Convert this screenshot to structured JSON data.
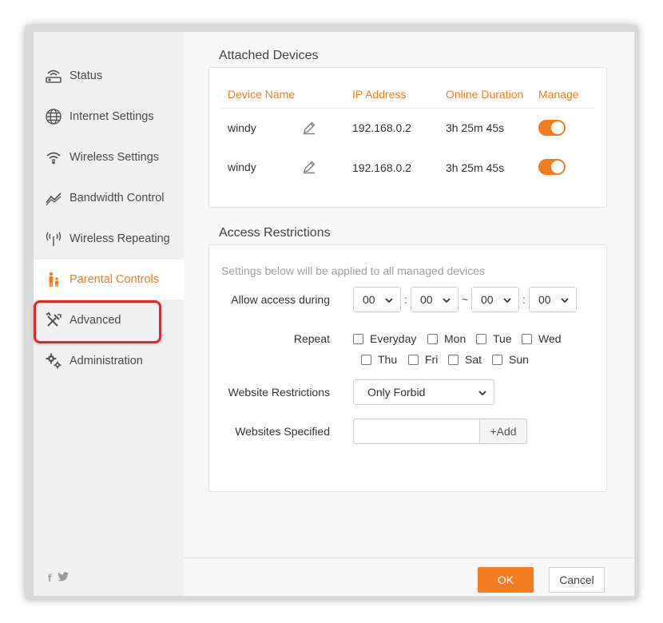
{
  "colors": {
    "accent": "#f47c20",
    "highlight": "#e0262b",
    "sidebar_bg": "#f0f0f0"
  },
  "sidebar": {
    "items": [
      {
        "label": "Status",
        "icon": "router-icon"
      },
      {
        "label": "Internet Settings",
        "icon": "globe-icon"
      },
      {
        "label": "Wireless Settings",
        "icon": "wifi-icon"
      },
      {
        "label": "Bandwidth Control",
        "icon": "bandwidth-icon"
      },
      {
        "label": "Wireless Repeating",
        "icon": "antenna-icon"
      },
      {
        "label": "Parental Controls",
        "icon": "family-icon",
        "active": true
      },
      {
        "label": "Advanced",
        "icon": "tools-icon"
      },
      {
        "label": "Administration",
        "icon": "gears-icon"
      }
    ],
    "social": {
      "facebook": "f",
      "twitter": "twitter-icon"
    }
  },
  "attached_devices": {
    "title": "Attached Devices",
    "columns": [
      "Device Name",
      "IP Address",
      "Online Duration",
      "Manage"
    ],
    "rows": [
      {
        "name": "windy",
        "ip": "192.168.0.2",
        "duration": "3h 25m 45s",
        "manage": true
      },
      {
        "name": "windy",
        "ip": "192.168.0.2",
        "duration": "3h 25m 45s",
        "manage": true
      }
    ]
  },
  "access_restrictions": {
    "title": "Access Restrictions",
    "hint": "Settings below will be applied to all managed devices",
    "allow_label": "Allow access during",
    "time": {
      "start_hour": "00",
      "start_min": "00",
      "end_hour": "00",
      "end_min": "00",
      "colon": ":",
      "tilde": "~"
    },
    "repeat_label": "Repeat",
    "days": [
      "Everyday",
      "Mon",
      "Tue",
      "Wed",
      "Thu",
      "Fri",
      "Sat",
      "Sun"
    ],
    "website_restrictions_label": "Website Restrictions",
    "website_restrictions_value": "Only Forbid",
    "websites_specified_label": "Websites Specified",
    "websites_input_value": "",
    "add_label": "+Add"
  },
  "footer": {
    "ok_label": "OK",
    "cancel_label": "Cancel"
  }
}
